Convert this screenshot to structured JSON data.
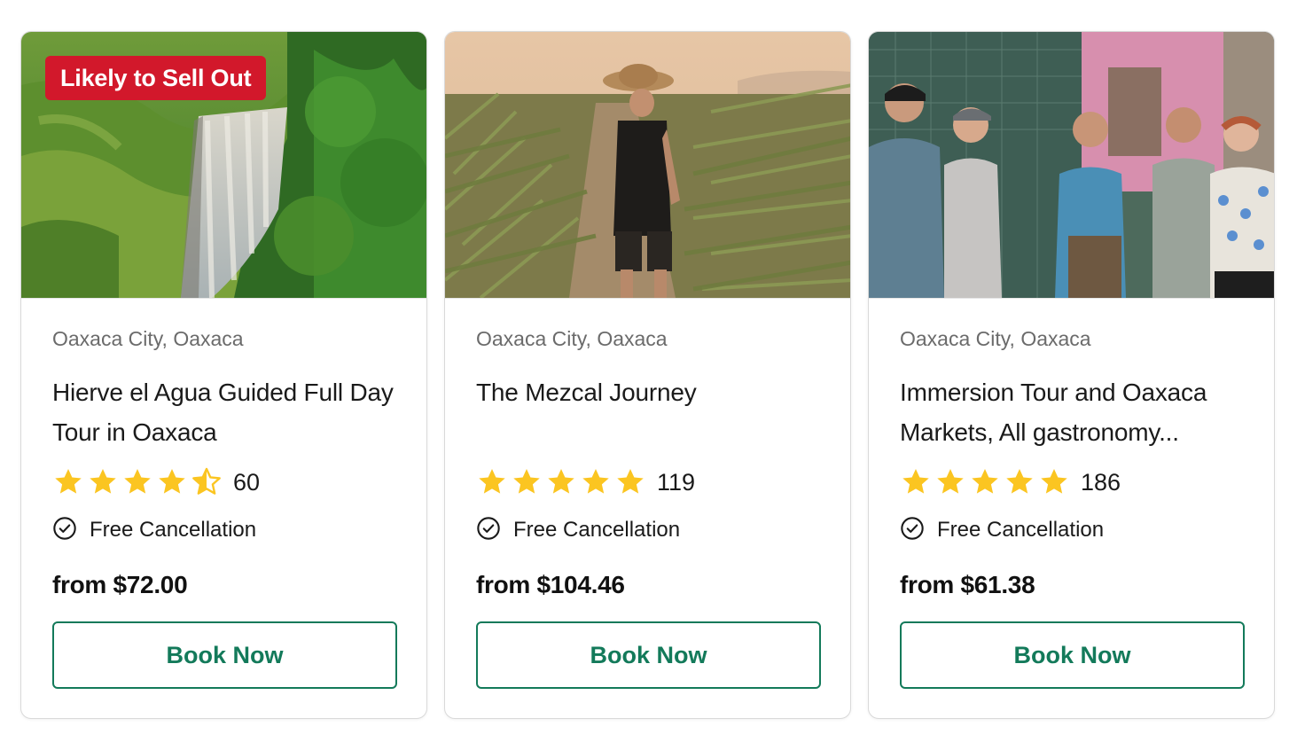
{
  "colors": {
    "accent": "#137a5a",
    "badge": "#d2182b",
    "star": "#fbc521",
    "muted_text": "#6b6b6b"
  },
  "cards": [
    {
      "badge": "Likely to Sell Out",
      "image": "hierve-el-agua-waterfall-photo",
      "location": "Oaxaca City, Oaxaca",
      "title": "Hierve el Agua Guided Full Day Tour in Oaxaca",
      "rating": 4.5,
      "review_count": "60",
      "cancellation": "Free Cancellation",
      "price": "from $72.00",
      "button": "Book Now"
    },
    {
      "badge": "",
      "image": "agave-field-person-photo",
      "location": "Oaxaca City, Oaxaca",
      "title": "The Mezcal Journey",
      "rating": 5,
      "review_count": "119",
      "cancellation": "Free Cancellation",
      "price": "from $104.46",
      "button": "Book Now"
    },
    {
      "badge": "",
      "image": "market-tasting-group-photo",
      "location": "Oaxaca City, Oaxaca",
      "title": "Immersion Tour and Oaxaca Markets, All gastronomy...",
      "rating": 5,
      "review_count": "186",
      "cancellation": "Free Cancellation",
      "price": "from $61.38",
      "button": "Book Now"
    }
  ]
}
